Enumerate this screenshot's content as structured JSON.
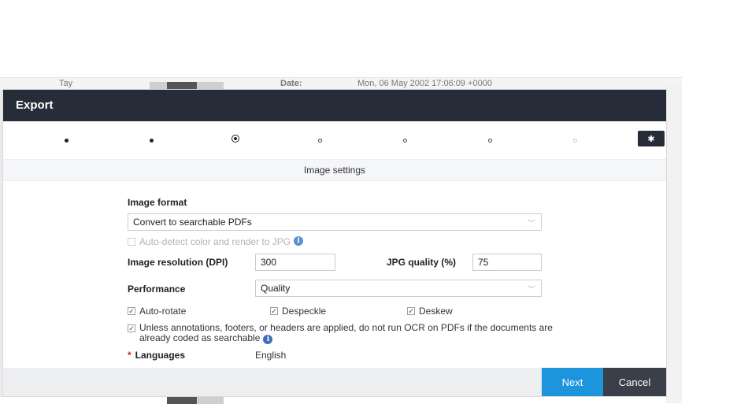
{
  "background": {
    "left_text": "Tay",
    "date_label": "Date:",
    "date_value": "Mon, 06 May 2002 17:06:09 +0000"
  },
  "modal": {
    "title": "Export",
    "section_title": "Image settings",
    "stepper": {
      "steps": [
        {
          "state": "done"
        },
        {
          "state": "done"
        },
        {
          "state": "current"
        },
        {
          "state": "upcoming"
        },
        {
          "state": "upcoming"
        },
        {
          "state": "upcoming"
        },
        {
          "state": "disabled"
        }
      ],
      "settings_icon": "gear-icon"
    },
    "form": {
      "image_format_label": "Image format",
      "image_format_value": "Convert to searchable PDFs",
      "auto_detect_label": "Auto-detect color and render to JPG",
      "auto_detect_checked": false,
      "resolution_label": "Image resolution (DPI)",
      "resolution_value": "300",
      "jpg_quality_label": "JPG quality (%)",
      "jpg_quality_value": "75",
      "performance_label": "Performance",
      "performance_value": "Quality",
      "auto_rotate_label": "Auto-rotate",
      "despeckle_label": "Despeckle",
      "deskew_label": "Deskew",
      "ocr_skip_label": "Unless annotations, footers, or headers are applied, do not run OCR on PDFs if the documents are already coded as searchable",
      "languages_label": "Languages",
      "languages_value": "English",
      "required_marker": "*"
    },
    "footer": {
      "next_label": "Next",
      "cancel_label": "Cancel"
    }
  },
  "colors": {
    "header": "#272d38",
    "primary": "#1c95dd",
    "cancel": "#3a3f4a",
    "info": "#3b6fb6"
  }
}
